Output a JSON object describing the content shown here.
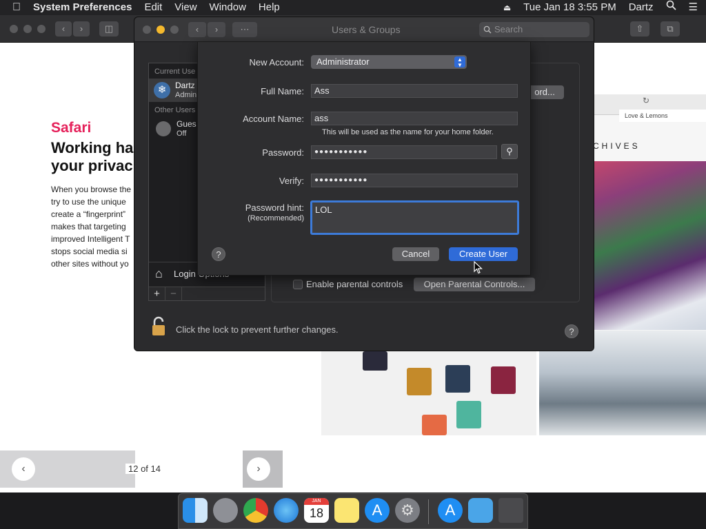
{
  "menubar": {
    "app_name": "System Preferences",
    "menus": [
      "Edit",
      "View",
      "Window",
      "Help"
    ],
    "clock": "Tue Jan 18  3:55 PM",
    "user": "Dartz"
  },
  "safari": {
    "heading": "Safari",
    "subheading": "Working ha your privac",
    "body_lines": [
      "When you browse the",
      "try to use the unique",
      "create a “fingerprint”",
      "makes that targeting",
      "improved Intelligent T",
      "stops social media si",
      "other sites without yo"
    ],
    "pager": {
      "label": "12 of 14",
      "prev": "‹",
      "next": "›"
    },
    "art": {
      "tab_label": "Love & Lemons",
      "archives": "CHIVES"
    }
  },
  "prefs": {
    "title": "Users & Groups",
    "search_placeholder": "Search",
    "current_users_header": "Current Use",
    "current_user_name": "Dartz",
    "current_user_role": "Admin",
    "other_users_header": "Other Users",
    "guest_name": "Gues",
    "guest_status": "Off",
    "login_options": "Login Options",
    "add_btn": "+",
    "remove_btn": "−",
    "password_btn": "ord...",
    "enable_parental": "Enable parental controls",
    "open_parental": "Open Parental Controls...",
    "lock_text": "Click the lock to prevent further changes.",
    "help": "?"
  },
  "sheet": {
    "new_account_label": "New Account:",
    "new_account_value": "Administrator",
    "full_name_label": "Full Name:",
    "full_name_value": "Ass",
    "account_name_label": "Account Name:",
    "account_name_value": "ass",
    "account_name_hint": "This will be used as the name for your home folder.",
    "password_label": "Password:",
    "password_value": "●●●●●●●●●●●",
    "verify_label": "Verify:",
    "verify_value": "●●●●●●●●●●●",
    "hint_label": "Password hint:",
    "hint_sub": "(Recommended)",
    "hint_value": "LOL",
    "help": "?",
    "cancel": "Cancel",
    "create": "Create User"
  },
  "dock": {
    "calendar_month": "JAN",
    "calendar_day": "18"
  },
  "colors": {
    "accent_blue": "#2f6bd8",
    "safari_pink": "#e5205a",
    "lock_gold": "#d9a34a"
  }
}
